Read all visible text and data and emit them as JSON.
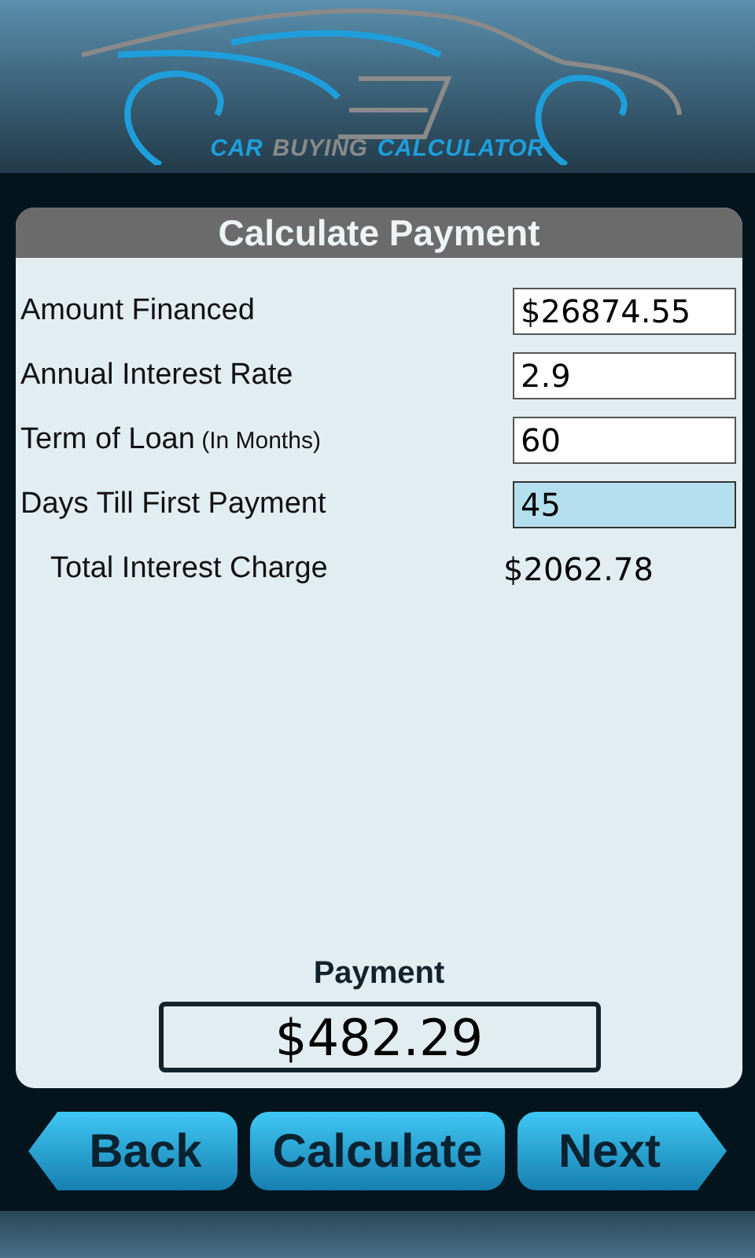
{
  "logo": {
    "words": [
      {
        "text": "CAR",
        "color": "#1e9fdc"
      },
      {
        "text": "BUYING",
        "color": "#8a8a8a"
      },
      {
        "text": "CALCULATOR",
        "color": "#1e9fdc"
      }
    ]
  },
  "panel": {
    "title": "Calculate Payment",
    "fields": [
      {
        "label": "Amount Financed",
        "value": "$26874.55",
        "focused": false
      },
      {
        "label": "Annual Interest Rate",
        "value": "2.9",
        "focused": false
      },
      {
        "label": "Term of Loan",
        "note": "(In Months)",
        "value": "60",
        "focused": false
      },
      {
        "label": "Days Till First Payment",
        "value": "45",
        "focused": true
      }
    ],
    "total": {
      "label": "Total Interest Charge",
      "value": "$2062.78"
    },
    "payment": {
      "label": "Payment",
      "value": "$482.29"
    }
  },
  "buttons": [
    {
      "label": "Back",
      "kind": "back"
    },
    {
      "label": "Calculate",
      "kind": "plain"
    },
    {
      "label": "Next",
      "kind": "next"
    }
  ]
}
